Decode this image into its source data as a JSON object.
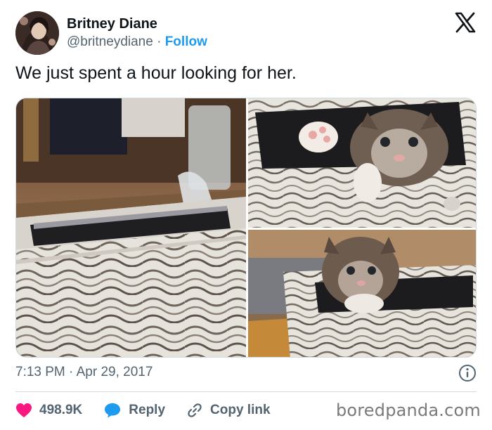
{
  "author": {
    "display_name": "Britney Diane",
    "handle": "@britneydiane",
    "separator": " · ",
    "follow_label": "Follow"
  },
  "tweet": {
    "text": "We just spent a hour looking for her.",
    "timestamp": "7:13 PM · Apr 29, 2017"
  },
  "actions": {
    "like_count": "498.9K",
    "reply_label": "Reply",
    "copy_link_label": "Copy link"
  },
  "watermark": "boredpanda.com",
  "icons": {
    "logo": "x-logo-icon",
    "info": "info-icon",
    "like": "heart-icon",
    "reply": "chat-bubble-icon",
    "copy": "link-icon"
  },
  "colors": {
    "accent": "#1d9bf0",
    "like": "#f91880",
    "secondary_text": "#536471",
    "primary_text": "#0f1419"
  }
}
